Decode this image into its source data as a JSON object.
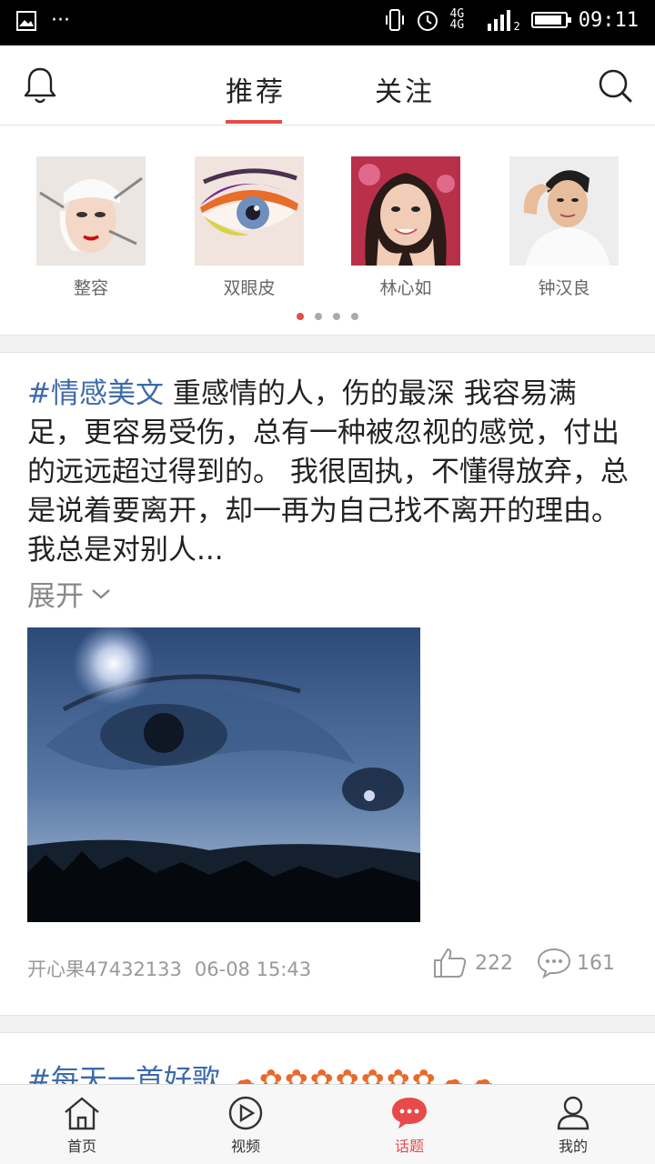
{
  "status_bar": {
    "time": "09:11",
    "network": "4G 4G",
    "sim_indicator": "2",
    "notification_dots": "···"
  },
  "header": {
    "tabs": [
      {
        "label": "推荐",
        "active": true
      },
      {
        "label": "关注",
        "active": false
      }
    ],
    "accent_color": "#e84a4a"
  },
  "topics": {
    "items": [
      {
        "label": "整容",
        "icon": "face-surgery-photo"
      },
      {
        "label": "双眼皮",
        "icon": "eye-makeup-photo"
      },
      {
        "label": "林心如",
        "icon": "woman-portrait-photo"
      },
      {
        "label": "钟汉良",
        "icon": "man-portrait-photo"
      }
    ],
    "page_count": 4,
    "active_page": 1
  },
  "post": {
    "hashtag": "#情感美文",
    "body": " 重感情的人，伤的最深 我容易满足，更容易受伤，总有一种被忽视的感觉，付出的远远超过得到的。 我很固执，不懂得放弃，总是说着要离开，却一再为自己找不离开的理由。 我总是对别人...",
    "expand_label": "展开",
    "author": "开心果47432133",
    "time": "06-08 15:43",
    "likes": "222",
    "comments": "161"
  },
  "post2": {
    "hashtag": "#每天一首好歌",
    "decoration": "☁✿✿✿✿✿✿✿☁☁"
  },
  "bottom_nav": [
    {
      "label": "首页",
      "icon": "home-icon",
      "active": false
    },
    {
      "label": "视频",
      "icon": "video-play-icon",
      "active": false
    },
    {
      "label": "话题",
      "icon": "chat-bubble-icon",
      "active": true
    },
    {
      "label": "我的",
      "icon": "user-icon",
      "active": false
    }
  ]
}
